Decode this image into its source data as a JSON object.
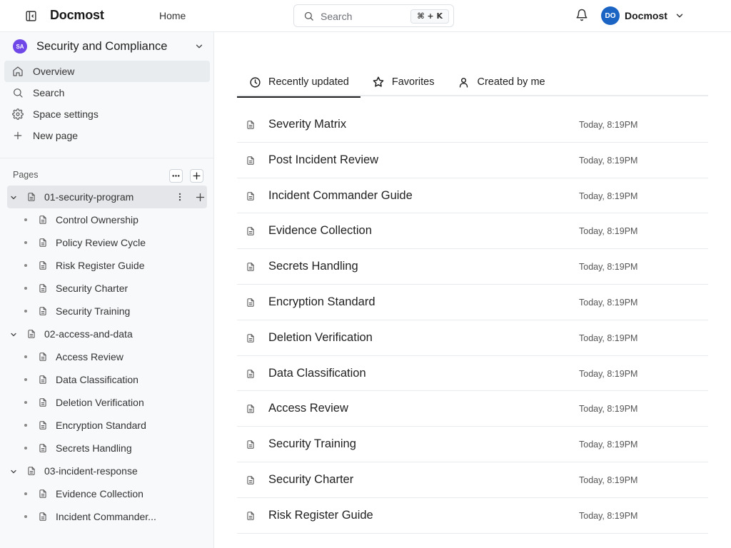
{
  "header": {
    "app_name": "Docmost",
    "home_label": "Home",
    "search_placeholder": "Search",
    "search_shortcut": "⌘ + K",
    "user_initials": "DO",
    "user_name": "Docmost",
    "avatar_color": "#1c64c4"
  },
  "sidebar": {
    "space_badge": "SA",
    "space_badge_color": "#7048e8",
    "space_name": "Security and Compliance",
    "nav": [
      {
        "label": "Overview",
        "icon": "home-icon",
        "active": true
      },
      {
        "label": "Search",
        "icon": "search-icon",
        "active": false
      },
      {
        "label": "Space settings",
        "icon": "gear-icon",
        "active": false
      },
      {
        "label": "New page",
        "icon": "plus-icon",
        "active": false
      }
    ],
    "pages_label": "Pages",
    "tree": [
      {
        "label": "01-security-program",
        "level": 0,
        "expanded": true,
        "selected": true
      },
      {
        "label": "Control Ownership",
        "level": 1
      },
      {
        "label": "Policy Review Cycle",
        "level": 1
      },
      {
        "label": "Risk Register Guide",
        "level": 1
      },
      {
        "label": "Security Charter",
        "level": 1
      },
      {
        "label": "Security Training",
        "level": 1
      },
      {
        "label": "02-access-and-data",
        "level": 0,
        "expanded": true
      },
      {
        "label": "Access Review",
        "level": 1
      },
      {
        "label": "Data Classification",
        "level": 1
      },
      {
        "label": "Deletion Verification",
        "level": 1
      },
      {
        "label": "Encryption Standard",
        "level": 1
      },
      {
        "label": "Secrets Handling",
        "level": 1
      },
      {
        "label": "03-incident-response",
        "level": 0,
        "expanded": true
      },
      {
        "label": "Evidence Collection",
        "level": 1
      },
      {
        "label": "Incident Commander...",
        "level": 1
      }
    ]
  },
  "main": {
    "tabs": [
      {
        "label": "Recently updated",
        "icon": "clock-icon",
        "active": true
      },
      {
        "label": "Favorites",
        "icon": "star-icon",
        "active": false
      },
      {
        "label": "Created by me",
        "icon": "user-icon",
        "active": false
      }
    ],
    "recent_pages": [
      {
        "title": "Severity Matrix",
        "time": "Today, 8:19PM"
      },
      {
        "title": "Post Incident Review",
        "time": "Today, 8:19PM"
      },
      {
        "title": "Incident Commander Guide",
        "time": "Today, 8:19PM"
      },
      {
        "title": "Evidence Collection",
        "time": "Today, 8:19PM"
      },
      {
        "title": "Secrets Handling",
        "time": "Today, 8:19PM"
      },
      {
        "title": "Encryption Standard",
        "time": "Today, 8:19PM"
      },
      {
        "title": "Deletion Verification",
        "time": "Today, 8:19PM"
      },
      {
        "title": "Data Classification",
        "time": "Today, 8:19PM"
      },
      {
        "title": "Access Review",
        "time": "Today, 8:19PM"
      },
      {
        "title": "Security Training",
        "time": "Today, 8:19PM"
      },
      {
        "title": "Security Charter",
        "time": "Today, 8:19PM"
      },
      {
        "title": "Risk Register Guide",
        "time": "Today, 8:19PM"
      }
    ]
  }
}
